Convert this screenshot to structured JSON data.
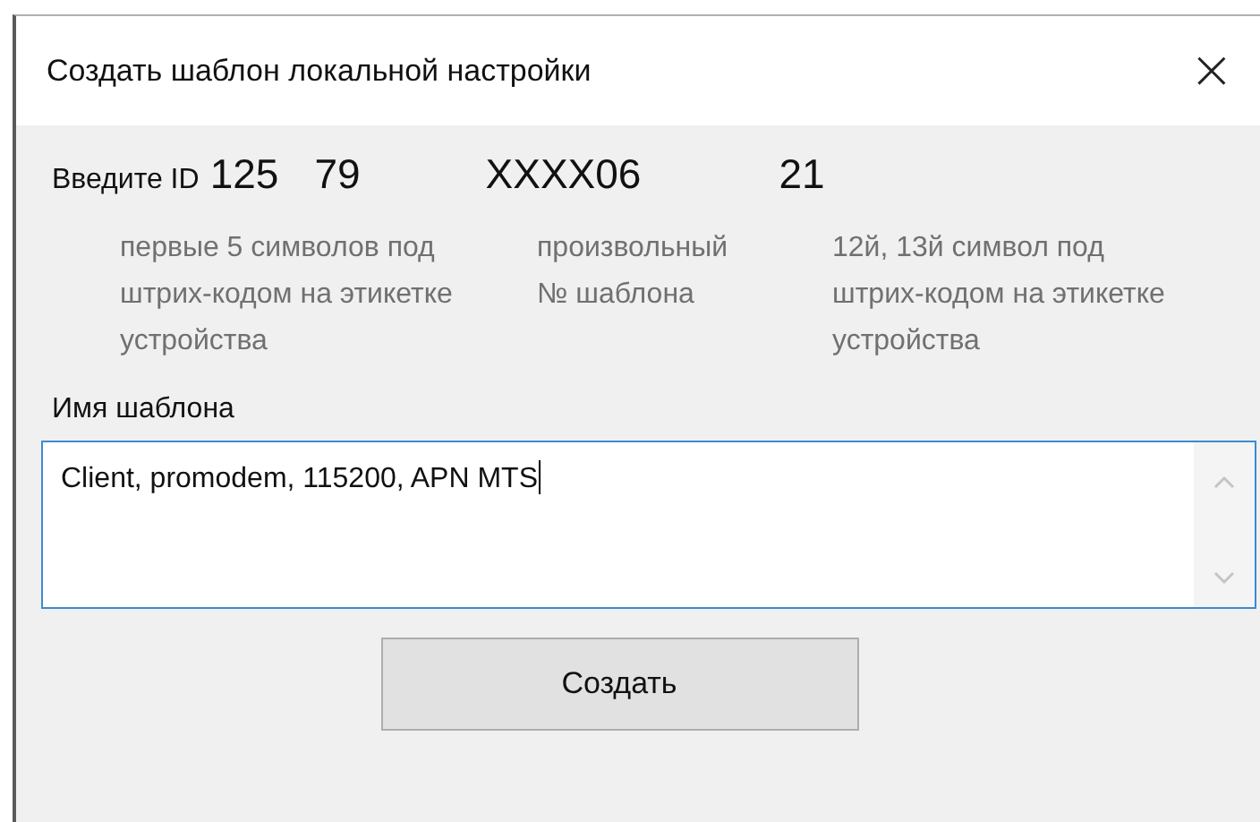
{
  "window": {
    "title": "Создать шаблон локальной настройки",
    "close": "×"
  },
  "id_row": {
    "label": "Введите ID",
    "parts": [
      "125",
      "79",
      "XXXX06",
      "21"
    ]
  },
  "hints": [
    "первые 5 символов под штрих-кодом на этикетке устройства",
    "произвольный № шаблона",
    "12й, 13й символ под штрих-кодом на этикетке устройства"
  ],
  "name_field": {
    "label": "Имя шаблона",
    "value": "Client, promodem, 115200, APN MTS"
  },
  "buttons": [
    "Создать"
  ]
}
